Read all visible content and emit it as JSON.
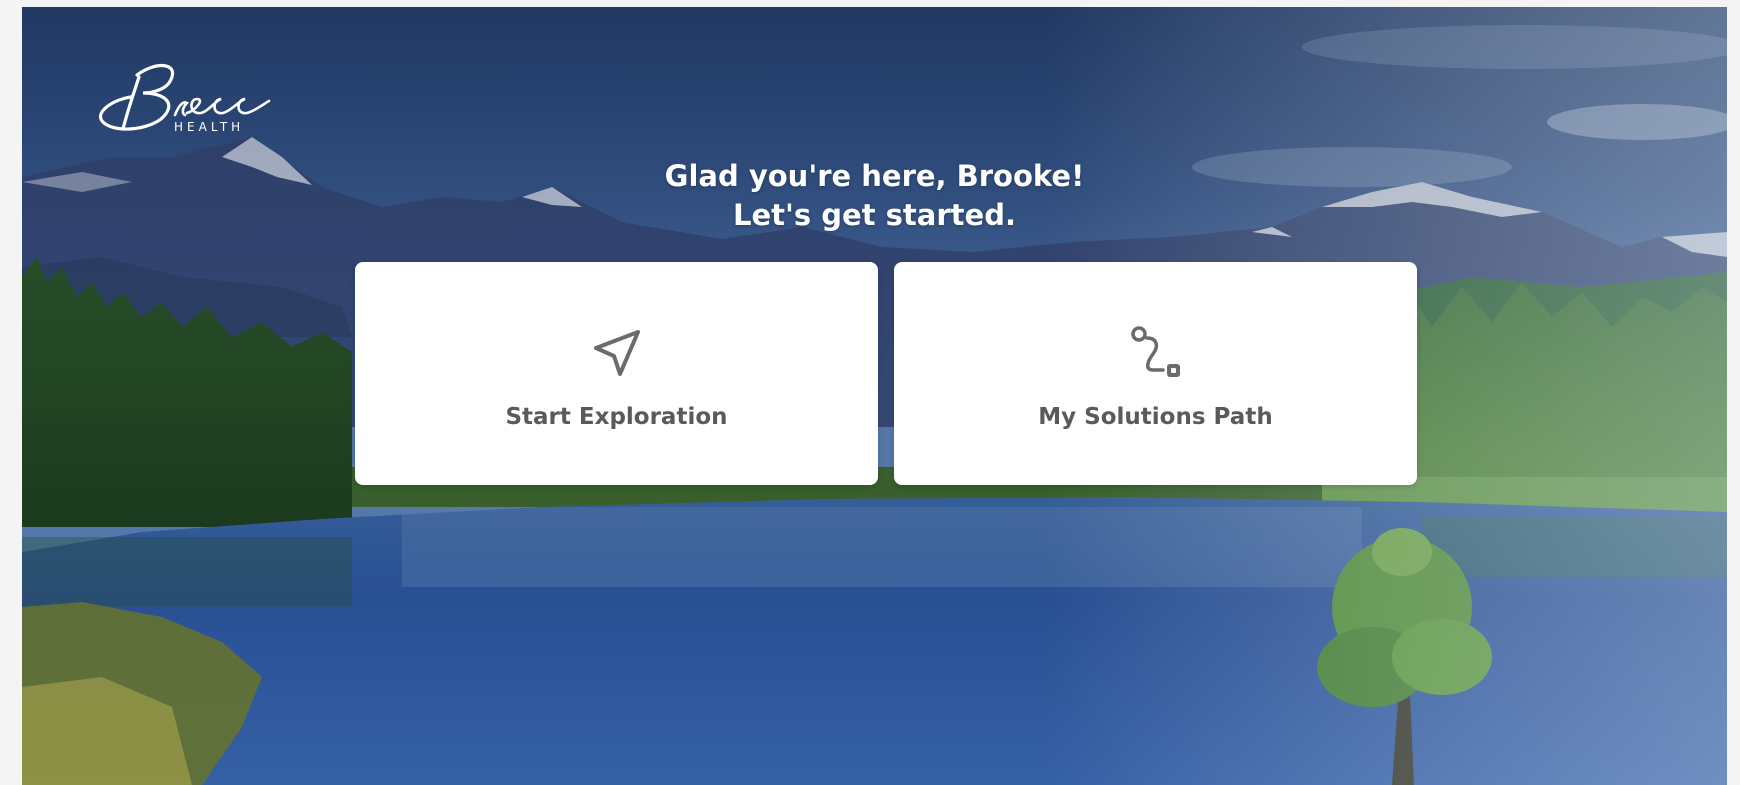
{
  "brand": {
    "script_name": "Bree",
    "subtitle": "HEALTH"
  },
  "greeting": {
    "line1": "Glad you're here, Brooke!",
    "line2": "Let's get started."
  },
  "cards": [
    {
      "label": "Start Exploration",
      "icon": "paper-plane-icon"
    },
    {
      "label": "My Solutions Path",
      "icon": "route-path-icon"
    }
  ],
  "colors": {
    "card_background": "#ffffff",
    "card_text": "#5a5a5a",
    "icon_stroke": "#6b6b6b",
    "greeting_text": "#ffffff"
  }
}
